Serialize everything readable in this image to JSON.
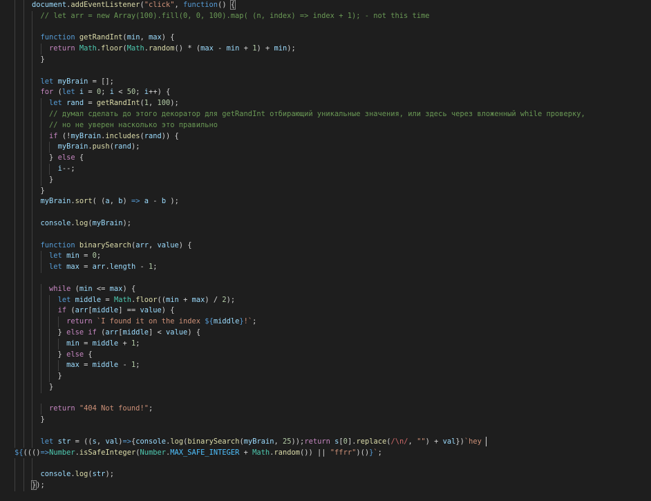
{
  "editor": {
    "lines": [
      [
        [
          "    ",
          "p"
        ],
        [
          "document",
          "v"
        ],
        [
          ".",
          "p"
        ],
        [
          "addEventListener",
          "f"
        ],
        [
          "(",
          "p"
        ],
        [
          "\"click\"",
          "s"
        ],
        [
          ", ",
          "p"
        ],
        [
          "function",
          "k"
        ],
        [
          "() ",
          "p"
        ],
        [
          "{",
          "p bm"
        ]
      ],
      [
        [
          "      ",
          "p"
        ],
        [
          "// let arr = new Array(100).fill(0, 0, 100).map( (n, index) => index + 1); - not this time",
          "m"
        ]
      ],
      [],
      [
        [
          "      ",
          "p"
        ],
        [
          "function",
          "k"
        ],
        [
          " ",
          "p"
        ],
        [
          "getRandInt",
          "f"
        ],
        [
          "(",
          "p"
        ],
        [
          "min",
          "v"
        ],
        [
          ", ",
          "p"
        ],
        [
          "max",
          "v"
        ],
        [
          ") {",
          "p"
        ]
      ],
      [
        [
          "        ",
          "p"
        ],
        [
          "return",
          "c"
        ],
        [
          " ",
          "p"
        ],
        [
          "Math",
          "t"
        ],
        [
          ".",
          "p"
        ],
        [
          "floor",
          "f"
        ],
        [
          "(",
          "p"
        ],
        [
          "Math",
          "t"
        ],
        [
          ".",
          "p"
        ],
        [
          "random",
          "f"
        ],
        [
          "() * (",
          "p"
        ],
        [
          "max",
          "v"
        ],
        [
          " - ",
          "p"
        ],
        [
          "min",
          "v"
        ],
        [
          " + ",
          "p"
        ],
        [
          "1",
          "n"
        ],
        [
          ") + ",
          "p"
        ],
        [
          "min",
          "v"
        ],
        [
          ");",
          "p"
        ]
      ],
      [
        [
          "      }",
          "p"
        ]
      ],
      [],
      [
        [
          "      ",
          "p"
        ],
        [
          "let",
          "k"
        ],
        [
          " ",
          "p"
        ],
        [
          "myBrain",
          "v"
        ],
        [
          " = [];",
          "p"
        ]
      ],
      [
        [
          "      ",
          "p"
        ],
        [
          "for",
          "c"
        ],
        [
          " (",
          "p"
        ],
        [
          "let",
          "k"
        ],
        [
          " ",
          "p"
        ],
        [
          "i",
          "v"
        ],
        [
          " = ",
          "p"
        ],
        [
          "0",
          "n"
        ],
        [
          "; ",
          "p"
        ],
        [
          "i",
          "v"
        ],
        [
          " < ",
          "p"
        ],
        [
          "50",
          "n"
        ],
        [
          "; ",
          "p"
        ],
        [
          "i",
          "v"
        ],
        [
          "++) {",
          "p"
        ]
      ],
      [
        [
          "        ",
          "p"
        ],
        [
          "let",
          "k"
        ],
        [
          " ",
          "p"
        ],
        [
          "rand",
          "v"
        ],
        [
          " = ",
          "p"
        ],
        [
          "getRandInt",
          "f"
        ],
        [
          "(",
          "p"
        ],
        [
          "1",
          "n"
        ],
        [
          ", ",
          "p"
        ],
        [
          "100",
          "n"
        ],
        [
          ");",
          "p"
        ]
      ],
      [
        [
          "        ",
          "p"
        ],
        [
          "// думал сделать до этого декоратор для getRandInt отбирающий уникальные значения, или здесь через вложенный while проверку,",
          "m"
        ]
      ],
      [
        [
          "        ",
          "p"
        ],
        [
          "// но не уверен насколько это правильно",
          "m"
        ]
      ],
      [
        [
          "        ",
          "p"
        ],
        [
          "if",
          "c"
        ],
        [
          " (!",
          "p"
        ],
        [
          "myBrain",
          "v"
        ],
        [
          ".",
          "p"
        ],
        [
          "includes",
          "f"
        ],
        [
          "(",
          "p"
        ],
        [
          "rand",
          "v"
        ],
        [
          ")) {",
          "p"
        ]
      ],
      [
        [
          "          ",
          "p"
        ],
        [
          "myBrain",
          "v"
        ],
        [
          ".",
          "p"
        ],
        [
          "push",
          "f"
        ],
        [
          "(",
          "p"
        ],
        [
          "rand",
          "v"
        ],
        [
          ");",
          "p"
        ]
      ],
      [
        [
          "        } ",
          "p"
        ],
        [
          "else",
          "c"
        ],
        [
          " {",
          "p"
        ]
      ],
      [
        [
          "          ",
          "p"
        ],
        [
          "i",
          "v"
        ],
        [
          "--;",
          "p"
        ]
      ],
      [
        [
          "        }",
          "p"
        ]
      ],
      [
        [
          "      }",
          "p"
        ]
      ],
      [
        [
          "      ",
          "p"
        ],
        [
          "myBrain",
          "v"
        ],
        [
          ".",
          "p"
        ],
        [
          "sort",
          "f"
        ],
        [
          "( (",
          "p"
        ],
        [
          "a",
          "v"
        ],
        [
          ", ",
          "p"
        ],
        [
          "b",
          "v"
        ],
        [
          ") ",
          "p"
        ],
        [
          "=>",
          "k"
        ],
        [
          " ",
          "p"
        ],
        [
          "a",
          "v"
        ],
        [
          " - ",
          "p"
        ],
        [
          "b",
          "v"
        ],
        [
          " );",
          "p"
        ]
      ],
      [],
      [
        [
          "      ",
          "p"
        ],
        [
          "console",
          "v"
        ],
        [
          ".",
          "p"
        ],
        [
          "log",
          "f"
        ],
        [
          "(",
          "p"
        ],
        [
          "myBrain",
          "v"
        ],
        [
          ");",
          "p"
        ]
      ],
      [],
      [
        [
          "      ",
          "p"
        ],
        [
          "function",
          "k"
        ],
        [
          " ",
          "p"
        ],
        [
          "binarySearch",
          "f"
        ],
        [
          "(",
          "p"
        ],
        [
          "arr",
          "v"
        ],
        [
          ", ",
          "p"
        ],
        [
          "value",
          "v"
        ],
        [
          ") {",
          "p"
        ]
      ],
      [
        [
          "        ",
          "p"
        ],
        [
          "let",
          "k"
        ],
        [
          " ",
          "p"
        ],
        [
          "min",
          "v"
        ],
        [
          " = ",
          "p"
        ],
        [
          "0",
          "n"
        ],
        [
          ";",
          "p"
        ]
      ],
      [
        [
          "        ",
          "p"
        ],
        [
          "let",
          "k"
        ],
        [
          " ",
          "p"
        ],
        [
          "max",
          "v"
        ],
        [
          " = ",
          "p"
        ],
        [
          "arr",
          "v"
        ],
        [
          ".",
          "p"
        ],
        [
          "length",
          "v"
        ],
        [
          " - ",
          "p"
        ],
        [
          "1",
          "n"
        ],
        [
          ";",
          "p"
        ]
      ],
      [],
      [
        [
          "        ",
          "p"
        ],
        [
          "while",
          "c"
        ],
        [
          " (",
          "p"
        ],
        [
          "min",
          "v"
        ],
        [
          " <= ",
          "p"
        ],
        [
          "max",
          "v"
        ],
        [
          ") {",
          "p"
        ]
      ],
      [
        [
          "          ",
          "p"
        ],
        [
          "let",
          "k"
        ],
        [
          " ",
          "p"
        ],
        [
          "middle",
          "v"
        ],
        [
          " = ",
          "p"
        ],
        [
          "Math",
          "t"
        ],
        [
          ".",
          "p"
        ],
        [
          "floor",
          "f"
        ],
        [
          "((",
          "p"
        ],
        [
          "min",
          "v"
        ],
        [
          " + ",
          "p"
        ],
        [
          "max",
          "v"
        ],
        [
          ") / ",
          "p"
        ],
        [
          "2",
          "n"
        ],
        [
          ");",
          "p"
        ]
      ],
      [
        [
          "          ",
          "p"
        ],
        [
          "if",
          "c"
        ],
        [
          " (",
          "p"
        ],
        [
          "arr",
          "v"
        ],
        [
          "[",
          "p"
        ],
        [
          "middle",
          "v"
        ],
        [
          "] == ",
          "p"
        ],
        [
          "value",
          "v"
        ],
        [
          ") {",
          "p"
        ]
      ],
      [
        [
          "            ",
          "p"
        ],
        [
          "return",
          "c"
        ],
        [
          " ",
          "p"
        ],
        [
          "`I found it on the index ",
          "s"
        ],
        [
          "${",
          "k"
        ],
        [
          "middle",
          "v"
        ],
        [
          "}",
          "k"
        ],
        [
          "!`",
          "s"
        ],
        [
          ";",
          "p"
        ]
      ],
      [
        [
          "          } ",
          "p"
        ],
        [
          "else",
          "c"
        ],
        [
          " ",
          "p"
        ],
        [
          "if",
          "c"
        ],
        [
          " (",
          "p"
        ],
        [
          "arr",
          "v"
        ],
        [
          "[",
          "p"
        ],
        [
          "middle",
          "v"
        ],
        [
          "] < ",
          "p"
        ],
        [
          "value",
          "v"
        ],
        [
          ") {",
          "p"
        ]
      ],
      [
        [
          "            ",
          "p"
        ],
        [
          "min",
          "v"
        ],
        [
          " = ",
          "p"
        ],
        [
          "middle",
          "v"
        ],
        [
          " + ",
          "p"
        ],
        [
          "1",
          "n"
        ],
        [
          ";",
          "p"
        ]
      ],
      [
        [
          "          } ",
          "p"
        ],
        [
          "else",
          "c"
        ],
        [
          " {",
          "p"
        ]
      ],
      [
        [
          "            ",
          "p"
        ],
        [
          "max",
          "v"
        ],
        [
          " = ",
          "p"
        ],
        [
          "middle",
          "v"
        ],
        [
          " - ",
          "p"
        ],
        [
          "1",
          "n"
        ],
        [
          ";",
          "p"
        ]
      ],
      [
        [
          "          }",
          "p"
        ]
      ],
      [
        [
          "        }",
          "p"
        ]
      ],
      [],
      [
        [
          "        ",
          "p"
        ],
        [
          "return",
          "c"
        ],
        [
          " ",
          "p"
        ],
        [
          "\"404 Not found!\"",
          "s"
        ],
        [
          ";",
          "p"
        ]
      ],
      [
        [
          "      }",
          "p"
        ]
      ],
      [],
      [
        [
          "      ",
          "p"
        ],
        [
          "let",
          "k"
        ],
        [
          " ",
          "p"
        ],
        [
          "str",
          "v"
        ],
        [
          " = ((",
          "p"
        ],
        [
          "s",
          "v"
        ],
        [
          ", ",
          "p"
        ],
        [
          "val",
          "v"
        ],
        [
          ")",
          "p"
        ],
        [
          "=>",
          "k"
        ],
        [
          "{",
          "p"
        ],
        [
          "console",
          "v"
        ],
        [
          ".",
          "p"
        ],
        [
          "log",
          "f"
        ],
        [
          "(",
          "p"
        ],
        [
          "binarySearch",
          "f"
        ],
        [
          "(",
          "p"
        ],
        [
          "myBrain",
          "v"
        ],
        [
          ", ",
          "p"
        ],
        [
          "25",
          "n"
        ],
        [
          "));",
          "p"
        ],
        [
          "return",
          "c"
        ],
        [
          " ",
          "p"
        ],
        [
          "s",
          "v"
        ],
        [
          "[",
          "p"
        ],
        [
          "0",
          "n"
        ],
        [
          "].",
          "p"
        ],
        [
          "replace",
          "f"
        ],
        [
          "(",
          "p"
        ],
        [
          "/\\n/",
          "r"
        ],
        [
          ", ",
          "p"
        ],
        [
          "\"\"",
          "s"
        ],
        [
          ") + ",
          "p"
        ],
        [
          "val",
          "v"
        ],
        [
          "})",
          "p"
        ],
        [
          "`hey ",
          "s"
        ],
        [
          "",
          "cursor"
        ]
      ],
      [
        [
          "${",
          "k"
        ],
        [
          "((",
          "p"
        ],
        [
          "()",
          "p"
        ],
        [
          "=>",
          "k"
        ],
        [
          "Number",
          "t"
        ],
        [
          ".",
          "p"
        ],
        [
          "isSafeInteger",
          "f"
        ],
        [
          "(",
          "p"
        ],
        [
          "Number",
          "t"
        ],
        [
          ".",
          "p"
        ],
        [
          "MAX_SAFE_INTEGER",
          "o"
        ],
        [
          " + ",
          "p"
        ],
        [
          "Math",
          "t"
        ],
        [
          ".",
          "p"
        ],
        [
          "random",
          "f"
        ],
        [
          "()) || ",
          "p"
        ],
        [
          "\"ffrr\"",
          "s"
        ],
        [
          ")()",
          "p"
        ],
        [
          "}",
          "k"
        ],
        [
          "`",
          "s"
        ],
        [
          ";",
          "p"
        ]
      ],
      [],
      [
        [
          "      ",
          "p"
        ],
        [
          "console",
          "v"
        ],
        [
          ".",
          "p"
        ],
        [
          "log",
          "f"
        ],
        [
          "(",
          "p"
        ],
        [
          "str",
          "v"
        ],
        [
          ");",
          "p"
        ]
      ],
      [
        [
          "    ",
          "p"
        ],
        [
          "}",
          "p bm"
        ],
        [
          ");",
          "p"
        ]
      ]
    ]
  }
}
